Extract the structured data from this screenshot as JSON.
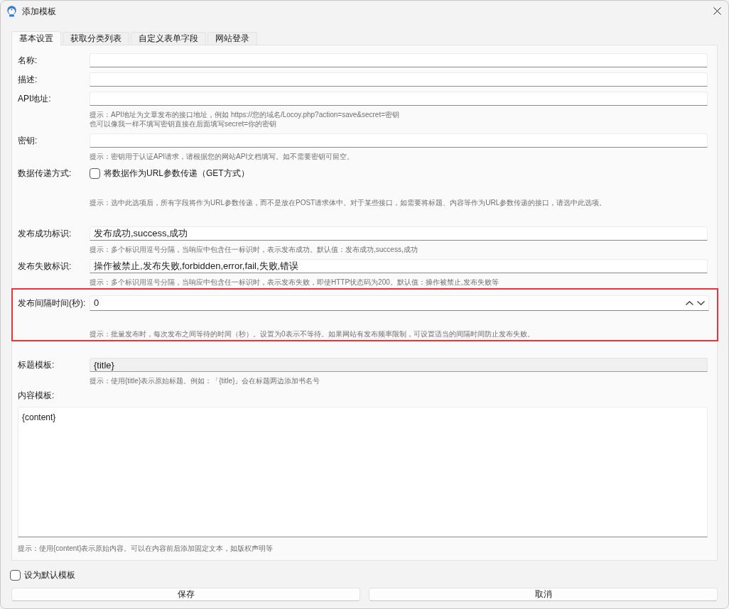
{
  "window": {
    "title": "添加模板"
  },
  "tabs": [
    {
      "label": "基本设置",
      "selected": true
    },
    {
      "label": "获取分类列表",
      "selected": false
    },
    {
      "label": "自定义表单字段",
      "selected": false
    },
    {
      "label": "网站登录",
      "selected": false
    }
  ],
  "form": [
    {
      "kind": "text",
      "label": "名称:",
      "disabled": false,
      "highlighted": false
    },
    {
      "kind": "text",
      "label": "描述:",
      "disabled": false,
      "highlighted": false
    },
    {
      "kind": "text",
      "label": "API地址:",
      "disabled": false,
      "highlighted": false,
      "hint": [
        "提示：API地址为文章发布的接口地址，例如 https://您的域名/Locoy.php?action=save&secret=密钥",
        "也可以像我一样不填写密钥直接在后面填写secret=你的密钥"
      ]
    },
    {
      "kind": "text",
      "label": "密钥:",
      "disabled": false,
      "highlighted": false,
      "hint": [
        "提示：密钥用于认证API请求，请根据您的网站API文档填写。如不需要密钥可留空。"
      ]
    },
    {
      "kind": "checkbox",
      "label": "数据传递方式:",
      "option": "将数据作为URL参数传递（GET方式）",
      "checked": false,
      "highlighted": false,
      "hint": [
        "提示：选中此选项后，所有字段将作为URL参数传递，而不是放在POST请求体中。对于某些接口，如需要将标题、内容等作为URL参数传递的接口，请选中此选项。"
      ]
    },
    {
      "kind": "text",
      "label": "发布成功标识:",
      "value": "发布成功,success,成功",
      "disabled": false,
      "highlighted": false,
      "hint": [
        "提示：多个标识用逗号分隔，当响应中包含任一标识时，表示发布成功。默认值：发布成功,success,成功"
      ]
    },
    {
      "kind": "text",
      "label": "发布失败标识:",
      "value": "操作被禁止,发布失败,forbidden,error,fail,失败,错误",
      "disabled": false,
      "highlighted": false,
      "hint": [
        "提示：多个标识用逗号分隔，当响应中包含任一标识时，表示发布失败，即使HTTP状态码为200。默认值：操作被禁止,发布失败等"
      ]
    },
    {
      "kind": "spin",
      "label": "发布间隔时间(秒):",
      "value": "0",
      "disabled": false,
      "highlighted": true,
      "hint": [
        "提示：批量发布时，每次发布之间等待的时间（秒）。设置为0表示不等待。如果网站有发布频率限制，可设置适当的间隔时间防止发布失败。"
      ]
    },
    {
      "kind": "text",
      "label": "标题模板:",
      "value": "{title}",
      "disabled": true,
      "highlighted": false,
      "hint": [
        "提示：使用{title}表示原始标题。例如：「{title}」会在标题两边添加书名号"
      ]
    },
    {
      "kind": "textarea",
      "label": "内容模板:",
      "value": "{content}",
      "disabled": false,
      "highlighted": false,
      "hint": [
        "提示：使用{content}表示原始内容。可以在内容前后添加固定文本，如版权声明等"
      ]
    }
  ],
  "default_template": {
    "label": "设为默认模板",
    "checked": false
  },
  "buttons": [
    "保存",
    "取消"
  ]
}
